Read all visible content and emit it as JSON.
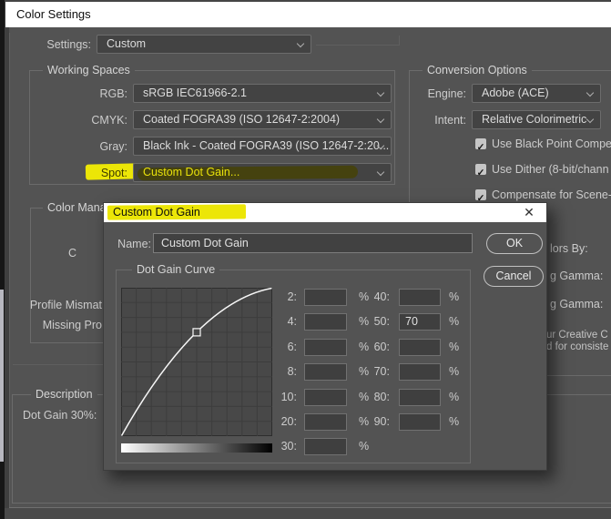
{
  "window": {
    "title": "Color Settings"
  },
  "settings": {
    "label": "Settings:",
    "value": "Custom"
  },
  "working_spaces": {
    "title": "Working Spaces",
    "rows": [
      {
        "label": "RGB:",
        "value": "sRGB IEC61966-2.1"
      },
      {
        "label": "CMYK:",
        "value": "Coated FOGRA39 (ISO 12647-2:2004)"
      },
      {
        "label": "Gray:",
        "value": "Black Ink - Coated FOGRA39 (ISO 12647-2:20..."
      },
      {
        "label": "Spot:",
        "value": "Custom Dot Gain...",
        "highlighted": true
      }
    ]
  },
  "conversion_options": {
    "title": "Conversion Options",
    "engine": {
      "label": "Engine:",
      "value": "Adobe (ACE)"
    },
    "intent": {
      "label": "Intent:",
      "value": "Relative Colorimetric"
    },
    "checkboxes": [
      {
        "label": "Use Black Point Compen",
        "checked": true
      },
      {
        "label": "Use Dither (8-bit/chann",
        "checked": true
      },
      {
        "label": "Compensate for Scene-",
        "checked": true
      }
    ]
  },
  "color_management": {
    "title_fragment": "Color Manage",
    "fragments": [
      "C",
      "Profile Mismat",
      "Missing Pro"
    ]
  },
  "description": {
    "title": "Description",
    "text": "Dot Gain 30%:"
  },
  "right_fragments": [
    "lors By:",
    "g Gamma:",
    "g Gamma:",
    "ur Creative C",
    "d for consiste"
  ],
  "dot_gain_dialog": {
    "title": "Custom Dot Gain",
    "name_label": "Name:",
    "name_value": "Custom Dot Gain",
    "ok_label": "OK",
    "cancel_label": "Cancel",
    "curve_group_title": "Dot Gain Curve",
    "percent": "%",
    "curve_point": {
      "input_percent": 50,
      "output_percent": 70
    },
    "fields_left": [
      {
        "label": "2:",
        "value": ""
      },
      {
        "label": "4:",
        "value": ""
      },
      {
        "label": "6:",
        "value": ""
      },
      {
        "label": "8:",
        "value": ""
      },
      {
        "label": "10:",
        "value": ""
      },
      {
        "label": "20:",
        "value": ""
      },
      {
        "label": "30:",
        "value": ""
      }
    ],
    "fields_right": [
      {
        "label": "40:",
        "value": ""
      },
      {
        "label": "50:",
        "value": "70"
      },
      {
        "label": "60:",
        "value": ""
      },
      {
        "label": "70:",
        "value": ""
      },
      {
        "label": "80:",
        "value": ""
      },
      {
        "label": "90:",
        "value": ""
      }
    ]
  },
  "colors": {
    "dialog_bg": "#535353",
    "titlebar_bg": "#ffffff",
    "highlight_yellow": "#ece607",
    "highlight_dark_olive": "#45420f",
    "field_bg": "#3f3f3f",
    "scroll_thumb": "#b7b7bf"
  }
}
